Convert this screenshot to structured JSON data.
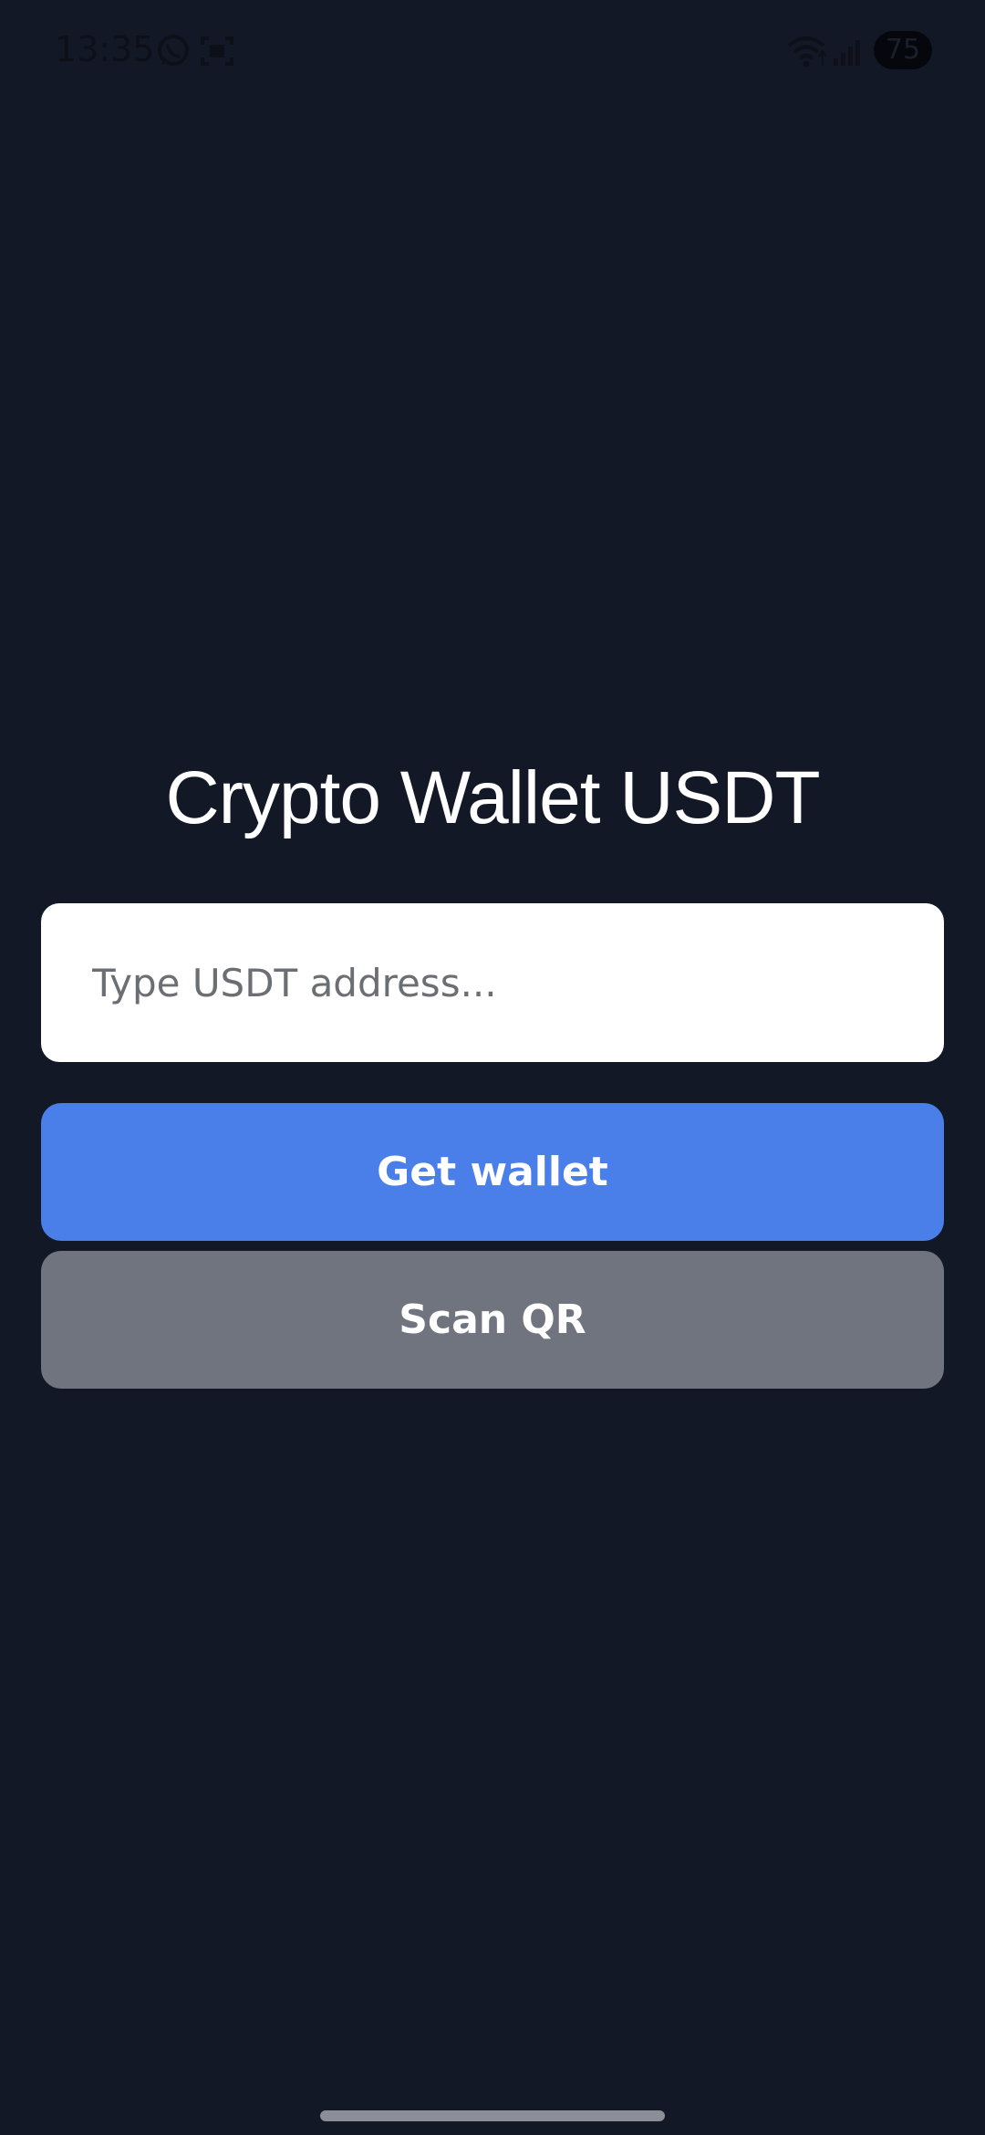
{
  "status_bar": {
    "time": "13:35",
    "battery_level": "75",
    "icons": [
      "whatsapp-icon",
      "screenshot-icon",
      "wifi-icon",
      "signal-icon",
      "battery-icon"
    ]
  },
  "main": {
    "title": "Crypto Wallet USDT",
    "address_input": {
      "placeholder": "Type USDT address...",
      "value": ""
    },
    "get_wallet_button": "Get wallet",
    "scan_qr_button": "Scan QR"
  },
  "colors": {
    "background": "#131826",
    "primary_button": "#4a7fe9",
    "secondary_button": "#6f747f",
    "input_background": "#ffffff",
    "title_text": "#ffffff"
  }
}
